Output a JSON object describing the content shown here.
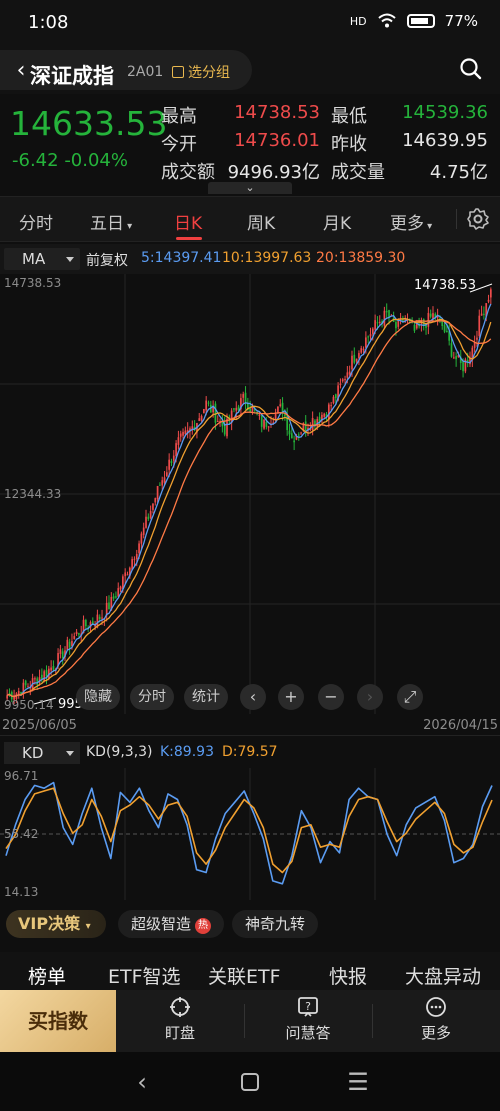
{
  "status": {
    "time": "1:08",
    "signal": "HD",
    "battery": "77%"
  },
  "header": {
    "name": "深证成指",
    "code": "2A01",
    "watch_label": "选分组"
  },
  "quote": {
    "price": "14633.53",
    "change": "-6.42",
    "change_pct": "-0.04%",
    "labels": {
      "high": "最高",
      "low": "最低",
      "open": "今开",
      "prev_close": "昨收",
      "turnover": "成交额",
      "volume": "成交量"
    },
    "values": {
      "high": "14738.53",
      "low": "14539.36",
      "open": "14736.01",
      "prev_close": "14639.95",
      "turnover": "9496.93亿",
      "volume": "4.75亿"
    },
    "colors": {
      "up": "#ee4b4b",
      "down": "#25b33b",
      "neutral": "#e6e6e6"
    }
  },
  "periods": [
    {
      "label": "分时"
    },
    {
      "label": "五日"
    },
    {
      "label": "日K"
    },
    {
      "label": "周K"
    },
    {
      "label": "月K"
    },
    {
      "label": "更多"
    }
  ],
  "active_period": "日K",
  "ma_bar": {
    "select": "MA",
    "adjust": "前复权",
    "ma5": "5:14397.41",
    "ma10": "10:13997.63",
    "ma20": "20:13859.30",
    "colors": {
      "ma5": "#5b9cf2",
      "ma10": "#f0a030",
      "ma20": "#ff7a45"
    }
  },
  "main_chart": {
    "ymax_label": "14738.53",
    "ymid_label": "12344.33",
    "ymin_label": "9950.14",
    "high_marker": "14738.53",
    "low_marker": "9950.14",
    "start_date": "2025/06/05",
    "end_date": "2026/04/15"
  },
  "tools": {
    "hide": "隐藏",
    "intraday": "分时",
    "stats": "统计"
  },
  "kd_bar": {
    "select": "KD",
    "params": "KD(9,3,3)",
    "k": "K:89.93",
    "d": "D:79.57"
  },
  "kd_chart": {
    "ymax_label": "96.71",
    "ymid_label": "55.42",
    "ymin_label": "14.13"
  },
  "strategies": {
    "vip": "VIP决策",
    "s1": "超级智造",
    "hot": "热",
    "s2": "神奇九转"
  },
  "info_tabs": [
    "榜单",
    "ETF智选",
    "关联ETF",
    "快报",
    "大盘异动"
  ],
  "actions": {
    "buy": "买指数",
    "watch": "盯盘",
    "ask": "问慧答",
    "more": "更多"
  },
  "chart_data": [
    {
      "type": "candlestick",
      "title": "",
      "xlabel": "",
      "ylabel": "",
      "x_start": "2025/06/05",
      "x_end": "2026/04/15",
      "ylim": [
        9950.14,
        14738.53
      ],
      "close_trend": [
        10050,
        10080,
        10150,
        10220,
        10300,
        10400,
        10550,
        10700,
        10820,
        10880,
        10950,
        11100,
        11300,
        11550,
        11800,
        12100,
        12400,
        12650,
        12900,
        13000,
        13150,
        13350,
        13200,
        13050,
        13280,
        13400,
        13250,
        13100,
        13200,
        13300,
        12950,
        13050,
        13150,
        13200,
        13300,
        13500,
        13750,
        13950,
        14100,
        14250,
        14350,
        14200,
        14300,
        14150,
        14250,
        14350,
        14200,
        13900,
        13750,
        13950,
        14350,
        14633.53
      ],
      "series": [
        {
          "name": "MA5",
          "last": 14397.41
        },
        {
          "name": "MA10",
          "last": 13997.63
        },
        {
          "name": "MA20",
          "last": 13859.3
        }
      ],
      "high": 14738.53,
      "low": 9950.14
    },
    {
      "type": "line",
      "title": "KD(9,3,3)",
      "ylim": [
        14.13,
        96.71
      ],
      "series": [
        {
          "name": "K",
          "values": [
            40,
            62,
            80,
            90,
            88,
            92,
            60,
            48,
            70,
            88,
            60,
            38,
            85,
            78,
            88,
            72,
            60,
            84,
            80,
            62,
            30,
            28,
            52,
            70,
            78,
            86,
            70,
            52,
            22,
            20,
            40,
            72,
            60,
            35,
            50,
            42,
            80,
            88,
            82,
            80,
            55,
            40,
            62,
            74,
            78,
            82,
            65,
            35,
            38,
            48,
            75,
            89.93
          ]
        },
        {
          "name": "D",
          "values": [
            45,
            55,
            72,
            84,
            86,
            88,
            70,
            56,
            62,
            80,
            68,
            50,
            72,
            76,
            82,
            76,
            66,
            76,
            78,
            68,
            42,
            34,
            44,
            60,
            70,
            80,
            74,
            60,
            34,
            28,
            36,
            60,
            62,
            46,
            48,
            46,
            68,
            80,
            82,
            80,
            64,
            50,
            56,
            66,
            72,
            78,
            70,
            48,
            42,
            46,
            64,
            79.57
          ]
        }
      ]
    }
  ]
}
